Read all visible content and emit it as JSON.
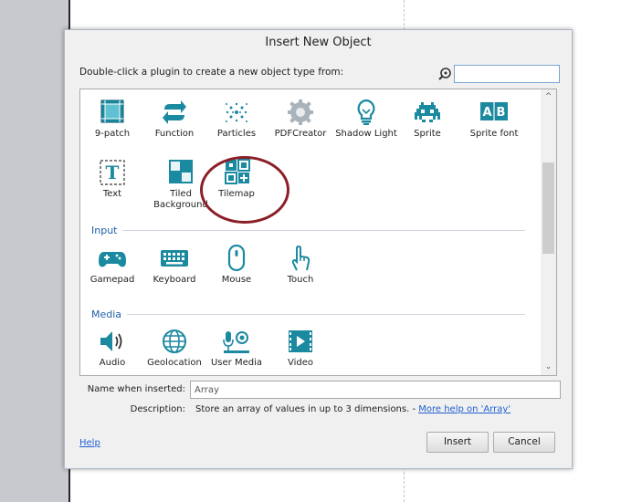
{
  "dialog": {
    "title": "Insert New Object",
    "hint": "Double-click a plugin to create a new object type from:",
    "search": {
      "value": "",
      "placeholder": ""
    }
  },
  "plugins": [
    {
      "label": "9-patch",
      "icon": "nine-patch-icon"
    },
    {
      "label": "Function",
      "icon": "function-icon"
    },
    {
      "label": "Particles",
      "icon": "particles-icon"
    },
    {
      "label": "PDFCreator",
      "icon": "pdfcreator-icon"
    },
    {
      "label": "Shadow Light",
      "icon": "shadow-light-icon"
    },
    {
      "label": "Sprite",
      "icon": "sprite-icon"
    },
    {
      "label": "Sprite font",
      "icon": "sprite-font-icon"
    },
    {
      "label": "Text",
      "icon": "text-icon"
    },
    {
      "label": "Tiled\nBackground",
      "icon": "tiled-background-icon"
    },
    {
      "label": "Tilemap",
      "icon": "tilemap-icon"
    }
  ],
  "sections": {
    "input": {
      "title": "Input",
      "items": [
        {
          "label": "Gamepad",
          "icon": "gamepad-icon"
        },
        {
          "label": "Keyboard",
          "icon": "keyboard-icon"
        },
        {
          "label": "Mouse",
          "icon": "mouse-icon"
        },
        {
          "label": "Touch",
          "icon": "touch-icon"
        }
      ]
    },
    "media": {
      "title": "Media",
      "items": [
        {
          "label": "Audio",
          "icon": "audio-icon"
        },
        {
          "label": "Geolocation",
          "icon": "geolocation-icon"
        },
        {
          "label": "User Media",
          "icon": "user-media-icon"
        },
        {
          "label": "Video",
          "icon": "video-icon"
        }
      ]
    }
  },
  "form": {
    "name_label": "Name when inserted:",
    "name_value": "Array",
    "description_label": "Description:",
    "description_text": "Store an array of values in up to 3 dimensions. - ",
    "description_link": "More help on 'Array'"
  },
  "footer": {
    "help": "Help",
    "insert": "Insert",
    "cancel": "Cancel"
  },
  "colors": {
    "icon_teal": "#1b8aa0",
    "section_blue": "#1f5fa8",
    "highlight_ring": "#8b1f28"
  }
}
